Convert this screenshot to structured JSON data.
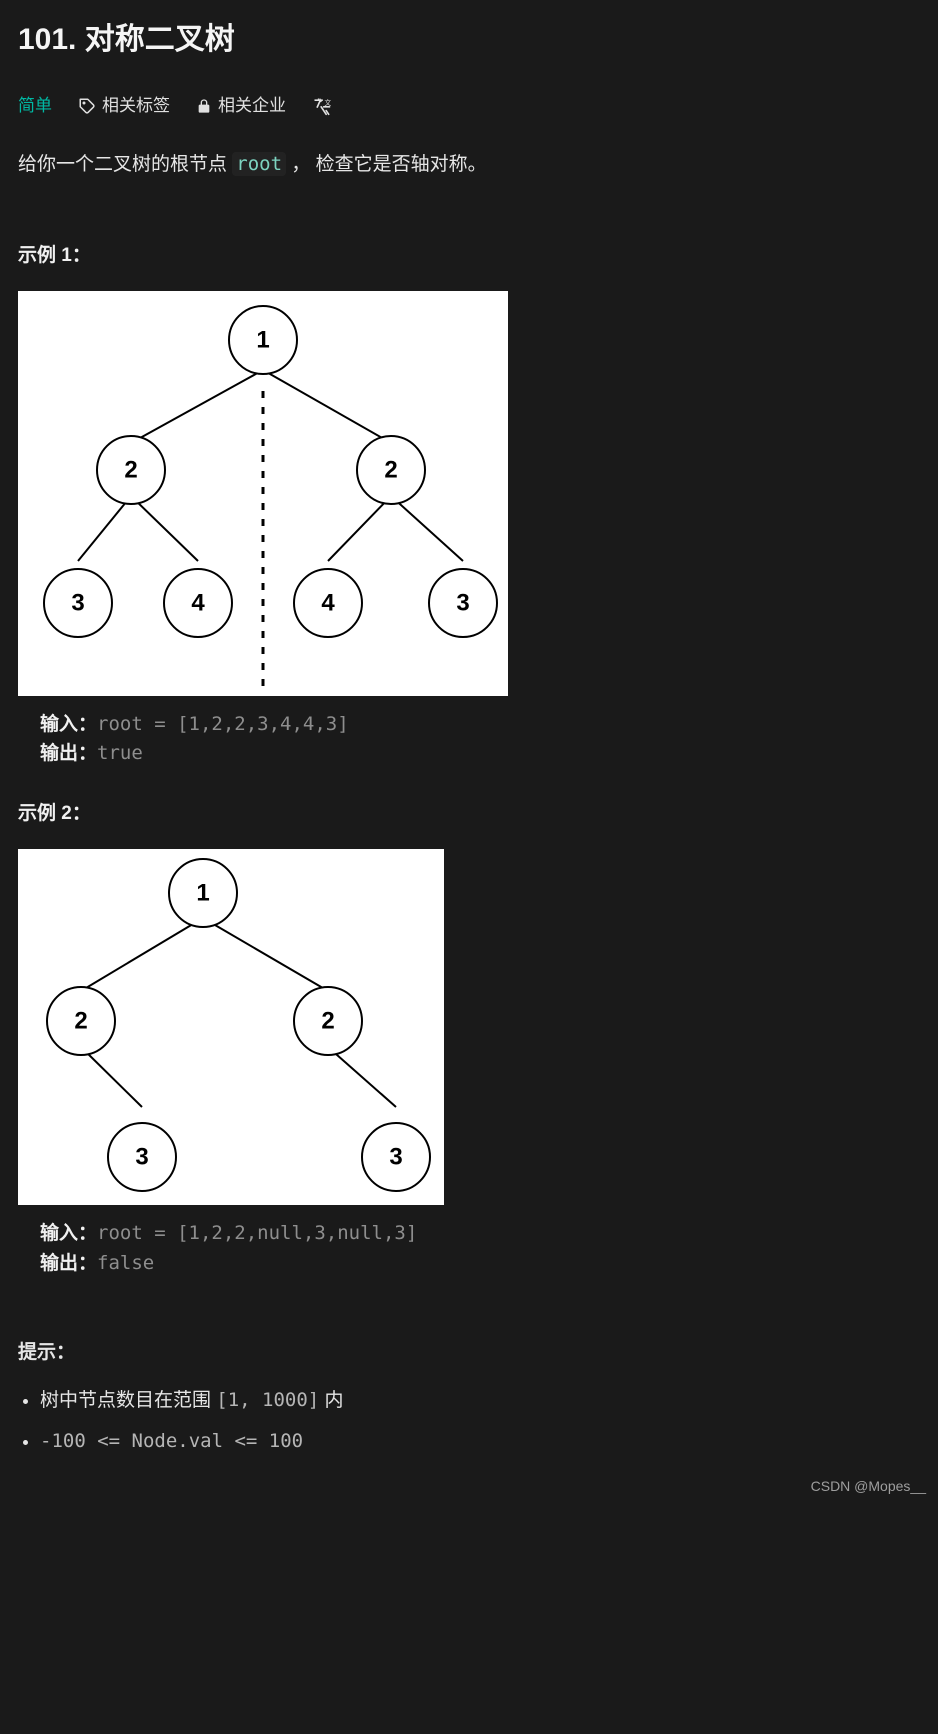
{
  "title": "101. 对称二叉树",
  "meta": {
    "difficulty": "简单",
    "tags_label": "相关标签",
    "companies_label": "相关企业"
  },
  "description_prefix": "给你一个二叉树的根节点 ",
  "description_code": "root",
  "description_suffix": " ， 检查它是否轴对称。",
  "example1": {
    "heading": "示例 1：",
    "input_label": "输入：",
    "input_value": "root = [1,2,2,3,4,4,3]",
    "output_label": "输出：",
    "output_value": "true"
  },
  "example2": {
    "heading": "示例 2：",
    "input_label": "输入：",
    "input_value": "root = [1,2,2,null,3,null,3]",
    "output_label": "输出：",
    "output_value": "false"
  },
  "hints": {
    "heading": "提示：",
    "item1_prefix": "树中节点数目在范围 ",
    "item1_code": "[1, 1000]",
    "item1_suffix": " 内",
    "item2_code": "-100 <= Node.val <= 100"
  },
  "tree1": {
    "nodes": [
      "1",
      "2",
      "2",
      "3",
      "4",
      "4",
      "3"
    ]
  },
  "tree2": {
    "nodes": [
      "1",
      "2",
      "2",
      "3",
      "3"
    ]
  },
  "watermark": "CSDN @Mopes__"
}
